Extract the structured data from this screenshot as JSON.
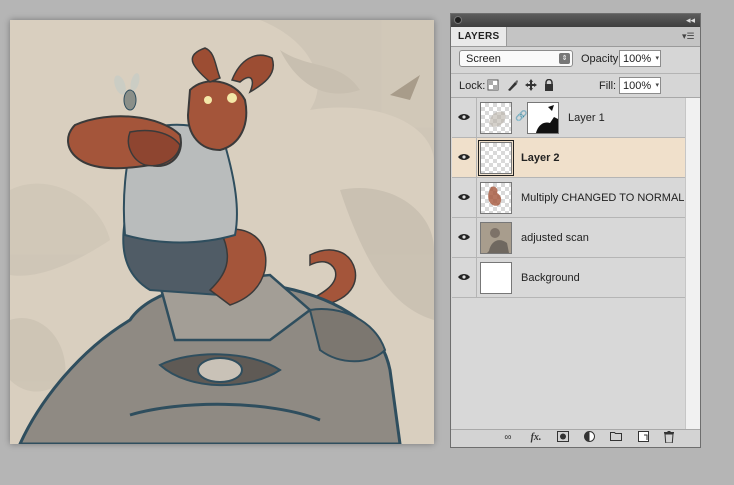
{
  "panel": {
    "tab_label": "LAYERS",
    "collapse_glyph": "◂◂",
    "menu_glyph": "▾☰"
  },
  "blend": {
    "mode": "Screen",
    "opacity_label": "Opacity:",
    "opacity_value": "100%",
    "lock_label": "Lock:",
    "fill_label": "Fill:",
    "fill_value": "100%"
  },
  "layers": [
    {
      "name": "Layer 1",
      "visible": true,
      "selected": false,
      "has_mask": true,
      "thumb": "checker-sketch"
    },
    {
      "name": "Layer 2",
      "visible": true,
      "selected": true,
      "has_mask": false,
      "thumb": "checker"
    },
    {
      "name": "Multiply CHANGED TO NORMAL",
      "visible": true,
      "selected": false,
      "has_mask": false,
      "thumb": "checker-red"
    },
    {
      "name": "adjusted scan",
      "visible": true,
      "selected": false,
      "has_mask": false,
      "thumb": "scan"
    },
    {
      "name": "Background",
      "visible": true,
      "selected": false,
      "has_mask": false,
      "thumb": "white"
    }
  ],
  "toolbar": {
    "link_icon": "link-layers-icon",
    "fx_label": "fx.",
    "mask_icon": "add-mask-icon",
    "adjustment_icon": "new-adjustment-icon",
    "group_icon": "new-group-icon",
    "new_layer_icon": "new-layer-icon",
    "delete_icon": "trash-icon"
  },
  "colors": {
    "selected_row": "#f0e0cb",
    "canvas_bg": "#d9cfbf",
    "skin": "#a4553a",
    "ink": "#2f4e5e"
  }
}
